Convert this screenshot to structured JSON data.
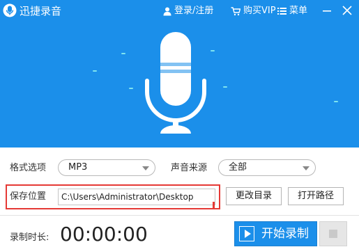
{
  "app": {
    "title": "迅捷录音",
    "icon": "microphone-logo-icon"
  },
  "titlebar": {
    "login_label": "登录/注册",
    "login_icon": "user-icon",
    "vip_label": "购买VIP",
    "vip_icon": "cart-icon",
    "menu_label": "菜单",
    "menu_icon": "menu-icon",
    "minimize_icon": "minimize-icon",
    "close_icon": "close-icon"
  },
  "settings": {
    "format_label": "格式选项",
    "format_value": "MP3",
    "source_label": "声音来源",
    "source_value": "全部",
    "save_label": "保存位置",
    "save_path": "C:\\Users\\Administrator\\Desktop",
    "change_dir_label": "更改目录",
    "open_path_label": "打开路径"
  },
  "recording": {
    "duration_label": "录制时长:",
    "duration_value": "00:00:00",
    "start_label": "开始录制"
  },
  "colors": {
    "primary": "#1b8fea",
    "highlight_frame": "#e53935",
    "accent_dash": "#7fe4f0"
  }
}
